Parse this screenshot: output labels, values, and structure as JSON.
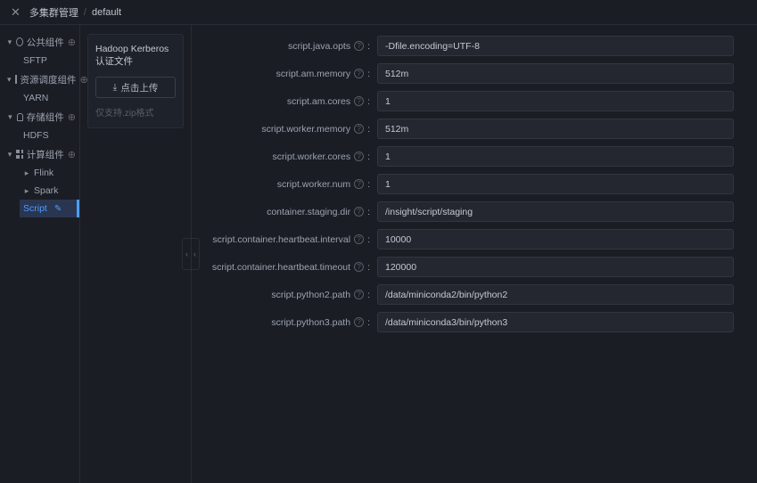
{
  "header": {
    "breadcrumb_root": "多集群管理",
    "breadcrumb_sep": "/",
    "breadcrumb_leaf": "default"
  },
  "tree": {
    "groups": [
      {
        "label": "公共组件",
        "items": [
          "SFTP"
        ]
      },
      {
        "label": "资源调度组件",
        "items": [
          "YARN"
        ]
      },
      {
        "label": "存储组件",
        "items": [
          "HDFS"
        ]
      },
      {
        "label": "计算组件",
        "items": [
          "Flink",
          "Spark",
          "Script"
        ],
        "active": "Script"
      }
    ]
  },
  "upload": {
    "title": "Hadoop Kerberos认证文件",
    "button": "点击上传",
    "hint": "仅支持.zip格式"
  },
  "form": {
    "rows": [
      {
        "label": "script.java.opts",
        "value": "-Dfile.encoding=UTF-8"
      },
      {
        "label": "script.am.memory",
        "value": "512m"
      },
      {
        "label": "script.am.cores",
        "value": "1"
      },
      {
        "label": "script.worker.memory",
        "value": "512m"
      },
      {
        "label": "script.worker.cores",
        "value": "1"
      },
      {
        "label": "script.worker.num",
        "value": "1"
      },
      {
        "label": "container.staging.dir",
        "value": "/insight/script/staging"
      },
      {
        "label": "script.container.heartbeat.interval",
        "value": "10000"
      },
      {
        "label": "script.container.heartbeat.timeout",
        "value": "120000"
      },
      {
        "label": "script.python2.path",
        "value": "/data/miniconda2/bin/python2"
      },
      {
        "label": "script.python3.path",
        "value": "/data/miniconda3/bin/python3"
      }
    ]
  }
}
